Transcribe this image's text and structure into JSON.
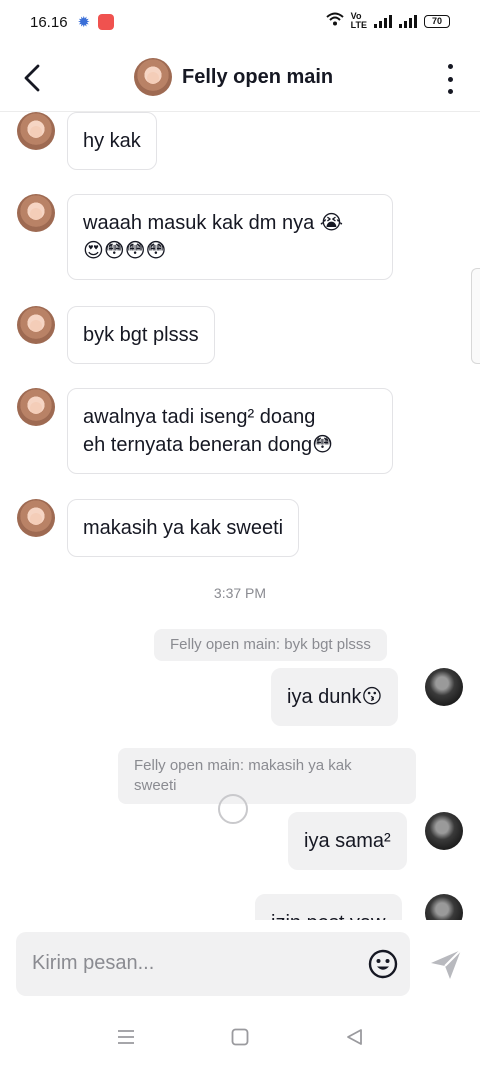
{
  "status": {
    "time": "16.16",
    "battery": "70"
  },
  "header": {
    "title": "Felly open main"
  },
  "messages": [
    {
      "text": "hy kak"
    },
    {
      "line1": "waaah masuk kak dm nya 😭",
      "line2": "😍😳😳😳"
    },
    {
      "text": "byk bgt plsss"
    },
    {
      "line1": "awalnya tadi iseng² doang",
      "line2": "eh ternyata beneran dong😳"
    },
    {
      "text": "makasih ya kak sweeti"
    }
  ],
  "timestamp": "3:37 PM",
  "replies": [
    {
      "ref": "Felly open main: byk bgt plsss",
      "text": "iya dunk😗"
    },
    {
      "ref_line1": "Felly open main: makasih ya kak",
      "ref_line2": "sweeti",
      "text": "iya sama²"
    },
    {
      "text": "izin post yaw"
    }
  ],
  "input": {
    "placeholder": "Kirim pesan..."
  },
  "icons": {
    "back": "back-arrow-icon",
    "more": "more-vertical-icon",
    "emoji": "emoji-icon",
    "send": "send-icon",
    "nav_menu": "menu-icon",
    "nav_home": "home-square-icon",
    "nav_back": "back-triangle-icon"
  }
}
